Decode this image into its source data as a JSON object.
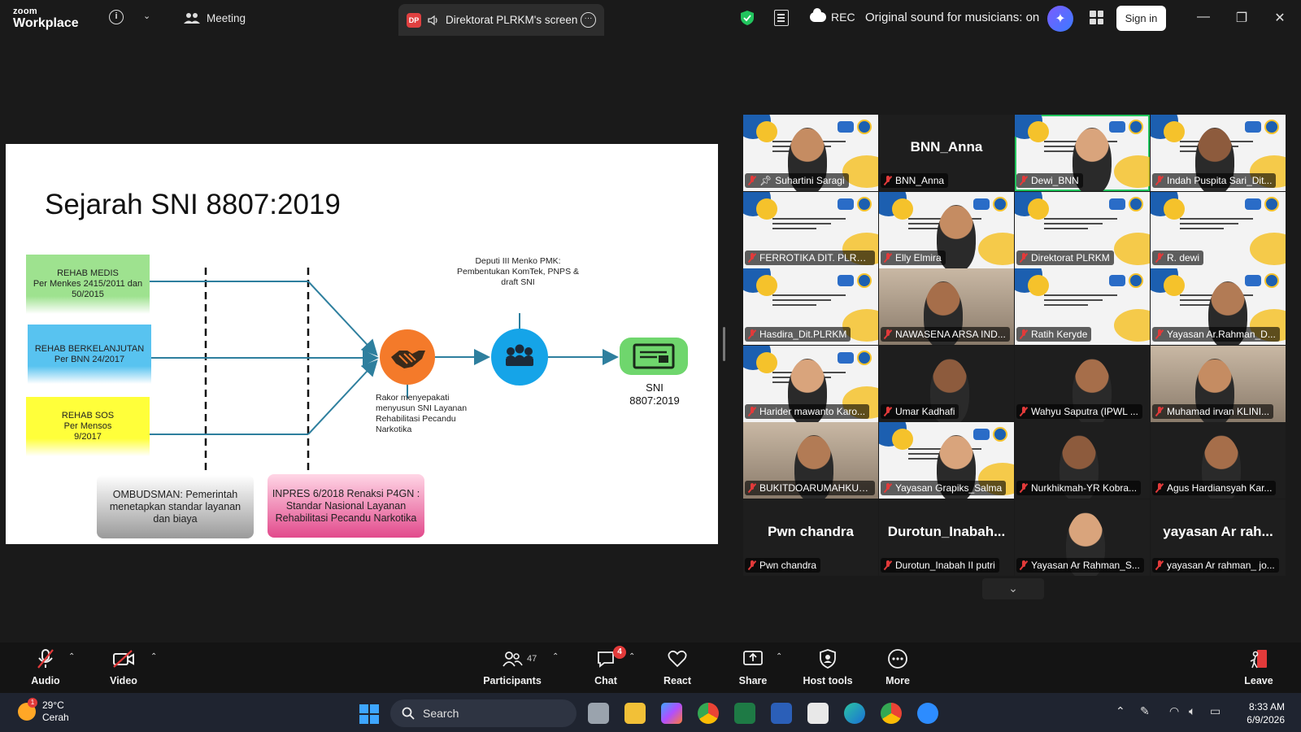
{
  "app": {
    "logo_line1": "zoom",
    "logo_line2": "Workplace",
    "meeting_label": "Meeting",
    "dp_badge": "DP",
    "screen_tab": "Direktorat PLRKM's screen",
    "rec_label": "REC",
    "original_sound": "Original sound for musicians: on",
    "signin_label": "Sign in"
  },
  "slide": {
    "title": "Sejarah SNI 8807:2019",
    "box_green": "REHAB MEDIS\nPer Menkes 2415/2011 dan 50/2015",
    "box_blue": "REHAB BERKELANJUTAN\nPer BNN 24/2017",
    "box_yellow": "REHAB SOS\nPer Mensos\n9/2017",
    "box_gray": "OMBUDSMAN: Pemerintah menetapkan standar layanan dan biaya",
    "box_pink": "INPRES 6/2018 Renaksi P4GN : Standar Nasional Layanan Rehabilitasi Pecandu Narkotika",
    "deputi_text": "Deputi III Menko PMK:\nPembentukan KomTek, PNPS &\ndraft SNI",
    "rakor_text": "Rakor menyepakati\nmenyusun SNI Layanan\nRehabilitasi Pecandu\nNarkotika",
    "sni_label": "SNI\n8807:2019"
  },
  "participants": [
    {
      "name": "Suhartini Saragi",
      "tile": "banner-person",
      "pinned": true
    },
    {
      "name": "BNN_Anna",
      "tile": "name",
      "big": "BNN_Anna"
    },
    {
      "name": "Dewi_BNN",
      "tile": "banner-person",
      "active": true
    },
    {
      "name": "Indah Puspita Sari_Dit...",
      "tile": "banner-person"
    },
    {
      "name": "FERROTIKA DIT. PLRKM",
      "tile": "banner"
    },
    {
      "name": "Elly Elmira",
      "tile": "banner-person"
    },
    {
      "name": "Direktorat PLRKM",
      "tile": "banner"
    },
    {
      "name": "R. dewi",
      "tile": "banner"
    },
    {
      "name": "Hasdira_Dit.PLRKM",
      "tile": "banner"
    },
    {
      "name": "NAWASENA ARSA IND...",
      "tile": "cam"
    },
    {
      "name": "Ratih Keryde",
      "tile": "banner"
    },
    {
      "name": "Yayasan Ar.Rahman_D...",
      "tile": "banner-person"
    },
    {
      "name": "Harider mawanto Karo...",
      "tile": "banner-person"
    },
    {
      "name": "Umar Kadhafi",
      "tile": "dark-person"
    },
    {
      "name": "Wahyu Saputra (IPWL ...",
      "tile": "dark-person"
    },
    {
      "name": "Muhamad irvan KLINI...",
      "tile": "cam"
    },
    {
      "name": "BUKITDOARUMAHKU_...",
      "tile": "cam"
    },
    {
      "name": "Yayasan Grapiks_Salma",
      "tile": "banner-person"
    },
    {
      "name": "Nurkhikmah-YR Kobra...",
      "tile": "dark-person"
    },
    {
      "name": "Agus Hardiansyah Kar...",
      "tile": "dark-person"
    },
    {
      "name": "Pwn chandra",
      "tile": "name",
      "big": "Pwn chandra"
    },
    {
      "name": "Durotun_Inabah II putri",
      "tile": "name",
      "big": "Durotun_Inabah..."
    },
    {
      "name": "Yayasan Ar Rahman_S...",
      "tile": "dark-person"
    },
    {
      "name": "yayasan Ar rahman_ jo...",
      "tile": "name",
      "big": "yayasan Ar rah..."
    }
  ],
  "toolbar": {
    "audio": "Audio",
    "video": "Video",
    "participants": "Participants",
    "participants_count": "47",
    "chat": "Chat",
    "chat_badge": "4",
    "react": "React",
    "share": "Share",
    "host_tools": "Host tools",
    "more": "More",
    "leave": "Leave"
  },
  "taskbar": {
    "weather_badge": "1",
    "temperature": "29°C",
    "weather": "Cerah",
    "search_placeholder": "Search",
    "time": "8:33 AM",
    "date": "6/9/2026"
  },
  "colors": {
    "active_speaker": "#22c55e",
    "muted_mic": "#e23a3a",
    "slide_orange": "#f47a2a",
    "slide_blue": "#15a4e8",
    "slide_green": "#6fd66d"
  }
}
